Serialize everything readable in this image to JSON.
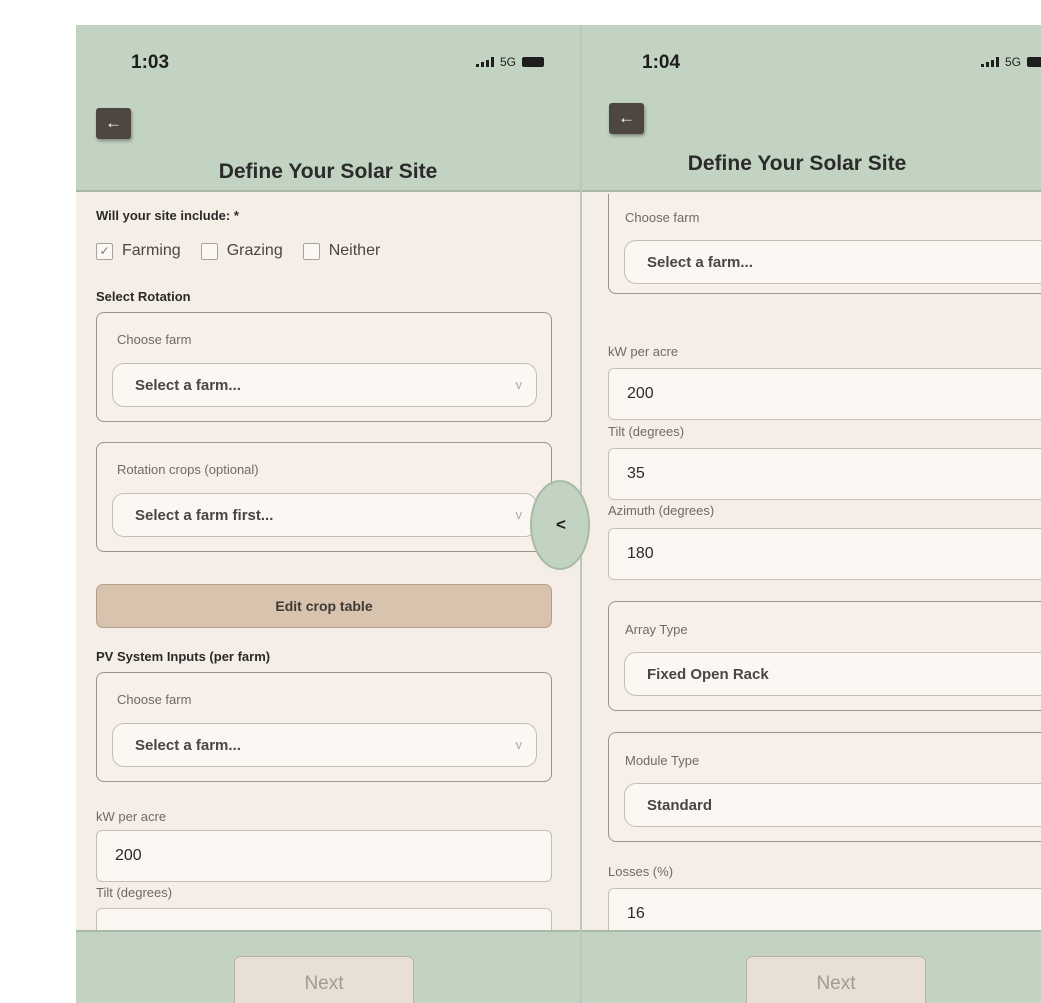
{
  "left_screen": {
    "status": {
      "time": "1:03",
      "network": "5G"
    },
    "header": {
      "title": "Define Your Solar Site"
    },
    "site_include": {
      "label": "Will your site include: *",
      "options": [
        {
          "label": "Farming",
          "checked": true
        },
        {
          "label": "Grazing",
          "checked": false
        },
        {
          "label": "Neither",
          "checked": false
        }
      ]
    },
    "rotation": {
      "section_label": "Select Rotation",
      "farm_label": "Choose farm",
      "farm_value": "Select a farm...",
      "crops_label": "Rotation crops (optional)",
      "crops_value": "Select a farm first..."
    },
    "edit_crop_table": "Edit crop table",
    "pv": {
      "section_label": "PV System Inputs (per farm)",
      "farm_label": "Choose farm",
      "farm_value": "Select a farm...",
      "kw_label": "kW per acre",
      "kw_value": "200",
      "tilt_label": "Tilt (degrees)"
    },
    "next": "Next"
  },
  "right_screen": {
    "status": {
      "time": "1:04",
      "network": "5G"
    },
    "header": {
      "title": "Define Your Solar Site"
    },
    "farm_label": "Choose farm",
    "farm_value": "Select a farm...",
    "kw_label": "kW per acre",
    "kw_value": "200",
    "tilt_label": "Tilt (degrees)",
    "tilt_value": "35",
    "azimuth_label": "Azimuth (degrees)",
    "azimuth_value": "180",
    "array_type_label": "Array Type",
    "array_type_value": "Fixed Open Rack",
    "module_type_label": "Module Type",
    "module_type_value": "Standard",
    "losses_label": "Losses (%)",
    "losses_value": "16",
    "next": "Next"
  },
  "icons": {
    "back": "←",
    "chevron_down": "v",
    "chevron_left": "<",
    "check": "✓"
  }
}
